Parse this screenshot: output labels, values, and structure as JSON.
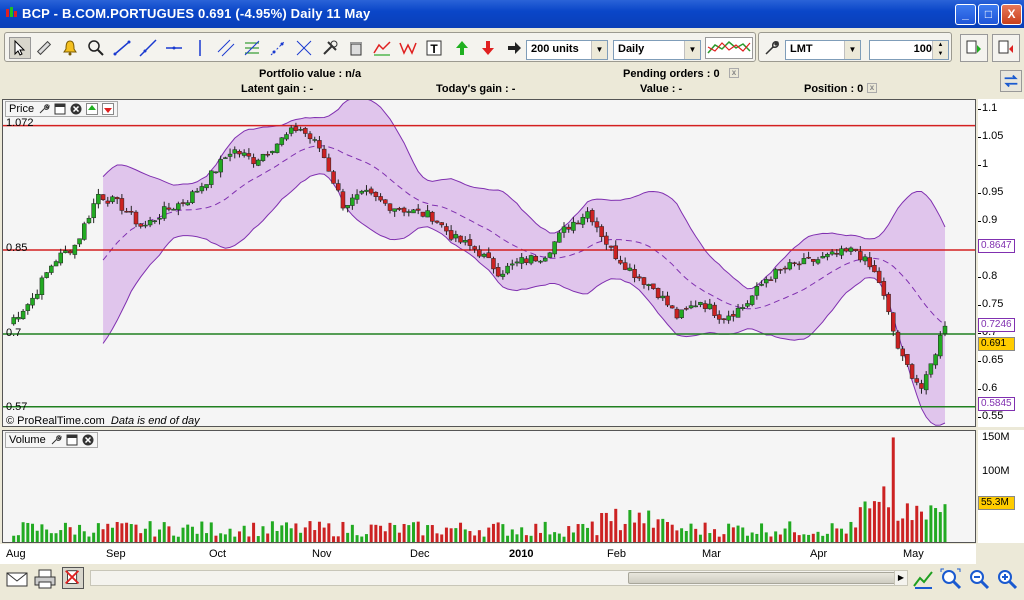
{
  "window": {
    "title": "BCP - B.COM.PORTUGUES    0.691  (-4.95%)    Daily  11 May",
    "minimize": "_",
    "maximize": "□",
    "close": "X"
  },
  "toolbar": {
    "units_value": "200 units",
    "period_value": "Daily",
    "order_type": "LMT",
    "quantity": "100"
  },
  "info": {
    "portfolio": "Portfolio value : n/a",
    "latent": "Latent gain : -",
    "today": "Today's gain : -",
    "pending": "Pending orders : 0",
    "value": "Value : -",
    "position": "Position : 0"
  },
  "price_panel": {
    "label": "Price",
    "footer_copyright": "© ProRealTime.com",
    "footer_note": "Data is end of day",
    "level_labels": [
      "1.072",
      "0.85",
      "0.7",
      "0.57"
    ],
    "axis_ticks": [
      "1.1",
      "1.05",
      "1",
      "0.95",
      "0.9",
      "0.85",
      "0.8",
      "0.75",
      "0.7",
      "0.65",
      "0.6",
      "0.55"
    ],
    "tags": {
      "upper_band": "0.8647",
      "middle_band": "0.7246",
      "last": "0.691",
      "lower_band": "0.5845"
    },
    "colors": {
      "up": "#22aa22",
      "down": "#cc2222",
      "band": "#d8b4e8",
      "band_line": "#8030b0",
      "red_level": "#d42020",
      "green_level": "#208020",
      "last_tag": "#ffcc00"
    }
  },
  "volume_panel": {
    "label": "Volume",
    "axis_ticks": [
      "150M",
      "100M",
      "50M"
    ],
    "tag": "55.3M"
  },
  "xaxis": {
    "labels": [
      "Aug",
      "Sep",
      "Oct",
      "Nov",
      "Dec",
      "2010",
      "Feb",
      "Mar",
      "Apr",
      "May"
    ]
  },
  "chart_data": {
    "type": "candlestick",
    "title": "BCP - B.COM.PORTUGUES",
    "ylim": [
      0.55,
      1.1
    ],
    "horizontal_levels": [
      1.072,
      0.85,
      0.7,
      0.57
    ],
    "months": [
      "Aug",
      "Sep",
      "Oct",
      "Nov",
      "Dec",
      "2010",
      "Feb",
      "Mar",
      "Apr",
      "May"
    ],
    "close_path": [
      0.72,
      0.76,
      0.83,
      0.86,
      0.95,
      0.93,
      0.89,
      0.92,
      0.94,
      0.98,
      1.03,
      1.01,
      1.04,
      1.07,
      1.03,
      0.93,
      0.95,
      0.93,
      0.92,
      0.91,
      0.87,
      0.85,
      0.81,
      0.83,
      0.84,
      0.89,
      0.92,
      0.85,
      0.81,
      0.78,
      0.73,
      0.76,
      0.73,
      0.75,
      0.8,
      0.82,
      0.83,
      0.84,
      0.85,
      0.8,
      0.66,
      0.6,
      0.72
    ],
    "last": 0.691,
    "change_pct": -4.95,
    "bollinger": {
      "upper": 0.8647,
      "middle": 0.7246,
      "lower": 0.5845
    },
    "volume_max": 150,
    "volume_last": 55.3
  }
}
